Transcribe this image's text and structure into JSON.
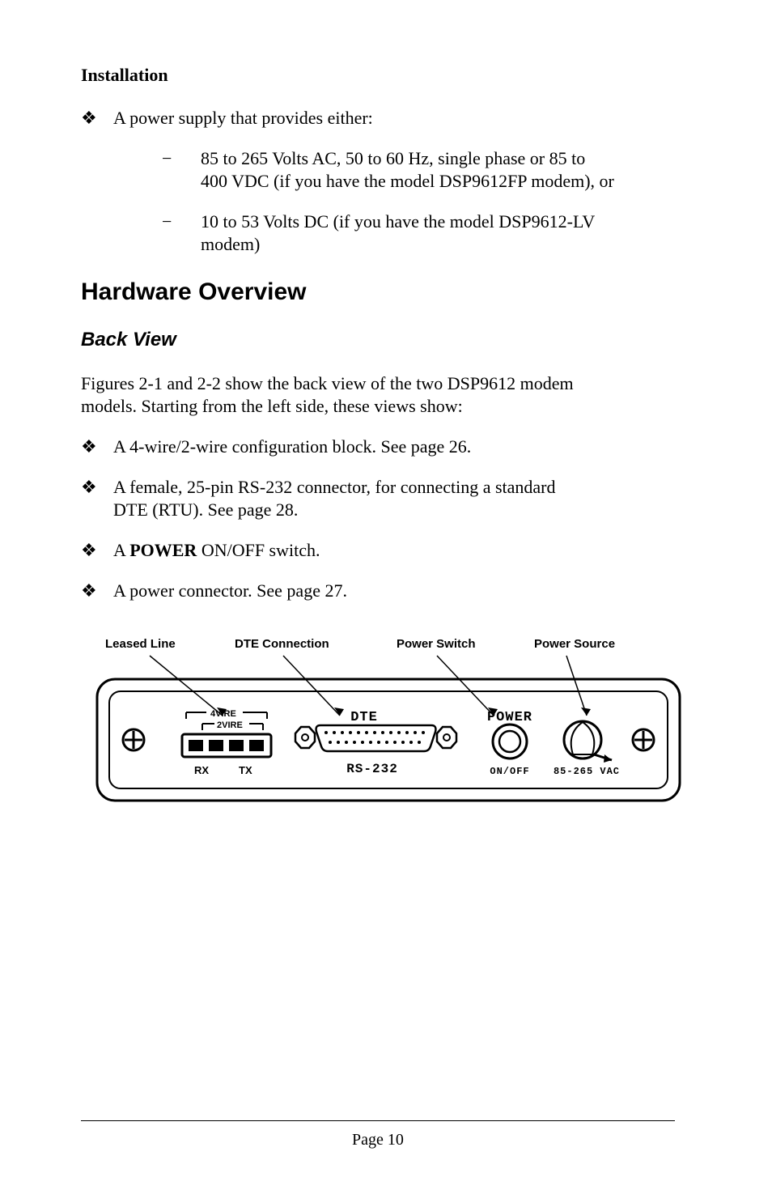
{
  "header": "Installation",
  "bullets": {
    "b1": "A power supply that provides either:",
    "sub1a": "85 to 265 Volts AC, 50 to 60 Hz, single phase or 85 to",
    "sub1b": "400 VDC (if you have the model DSP9612FP modem), or",
    "sub2a": "10 to 53 Volts DC (if you have the model DSP9612-LV",
    "sub2b": "modem)"
  },
  "h1": "Hardware Overview",
  "h2": "Back View",
  "para1a": "Figures 2-1 and 2-2 show the back view of the two DSP9612 modem",
  "para1b": "models. Starting from the left side, these views show:",
  "bullets2": {
    "b1": "A 4-wire/2-wire configuration block. See page 26.",
    "b2a": "A female, 25-pin RS-232 connector, for connecting a standard",
    "b2b": "DTE (RTU). See page 28.",
    "b3_pre": "A ",
    "b3_bold": "POWER",
    "b3_post": " ON/OFF switch.",
    "b4": "A power connector. See page 27."
  },
  "diagram": {
    "label_leased": "Leased Line",
    "label_dte_conn": "DTE Connection",
    "label_pswitch": "Power Switch",
    "label_psource": "Power Source",
    "panel": {
      "fourwire": "4VIRE",
      "twowire": "2VIRE",
      "rx": "RX",
      "tx": "TX",
      "dte": "DTE",
      "rs232": "RS-232",
      "power": "POWER",
      "onoff": "ON/OFF",
      "vac": "85-265 VAC"
    }
  },
  "footer": "Page 10"
}
